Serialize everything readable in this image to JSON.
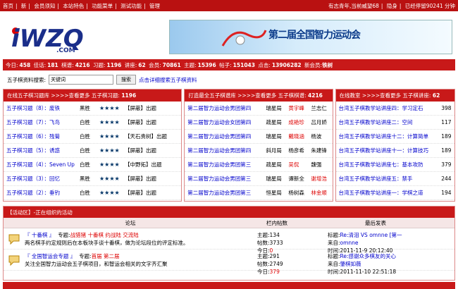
{
  "topbar": {
    "nav": [
      "首页",
      "新",
      "会员须知",
      "本站特色",
      "功能菜单",
      "测试功能",
      "管理"
    ],
    "greeting": "有志青年,当前威望68",
    "stealth": "隐身",
    "status": "已经停留90241 分钟"
  },
  "logo": {
    "text": "iWZQ",
    "sub": ".COM"
  },
  "banner": {
    "text": "第二届全国智力运动会",
    "colors": [
      "#9bc9ee",
      "#0b3b8a"
    ]
  },
  "stats": {
    "today_label": "今日:",
    "today": "458",
    "topics_label": "佳话:",
    "topics": "181",
    "chess_label": "棋谱:",
    "chess": "4216",
    "exercises_label": "习题:",
    "exercises": "1196",
    "lectures_label": "讲座:",
    "lectures": "62",
    "members_label": "会员:",
    "members": "70861",
    "topics2_label": "主题:",
    "topics2": "15396",
    "posts_label": "帖子:",
    "posts": "151043",
    "clicks_label": "点击:",
    "clicks": "13906282",
    "new_member_label": "新会员:",
    "new_member": "铁树"
  },
  "search": {
    "label": "五子棋资料搜索:",
    "value": "关键词",
    "button": "搜索",
    "advanced": "点击详细搜索五子棋资料"
  },
  "panel1": {
    "title": "在线五子棋习题库 >>>>查看更多 五子棋习题:",
    "count": "1196",
    "rows": [
      {
        "name": "五子棋习题（8）：废铁",
        "side": "黑胜",
        "stars": "★★★★",
        "tag": "【屏蔽】出题"
      },
      {
        "name": "五子棋习题（7）：飞鸟",
        "side": "白胜",
        "stars": "★★★★",
        "tag": "【屏蔽】出题"
      },
      {
        "name": "五子棋习题（6）：残菊",
        "side": "白胜",
        "stars": "★★★★",
        "tag": "【天石贵树】出题"
      },
      {
        "name": "五子棋习题（5）：诱惑",
        "side": "白胜",
        "stars": "★★★★",
        "tag": "【屏蔽】出题"
      },
      {
        "name": "五子棋习题（4）：Seven Up",
        "side": "白胜",
        "stars": "★★★★",
        "tag": "【中野拓】出题"
      },
      {
        "name": "五子棋习题（3）：回忆",
        "side": "黑胜",
        "stars": "★★★★",
        "tag": "【屏蔽】出题"
      },
      {
        "name": "五子棋习题（2）：垂钓",
        "side": "白胜",
        "stars": "★★★★",
        "tag": "【屏蔽】出题"
      }
    ]
  },
  "panel2": {
    "title": "打造最全五子棋谱库 >>>>查看更多 五子棋棋谱:",
    "count": "4216",
    "rows": [
      {
        "name": "第二届智力运动会男团第四",
        "c2": "瑞星局",
        "c3": "黄宇峰",
        "c4": "兰志仁",
        "red": true
      },
      {
        "name": "第二届智力运动会女团第四",
        "c2": "疏星局",
        "c3": "成艳珍",
        "c4": "吕月娇",
        "red": true
      },
      {
        "name": "第二届智力运动会男团第四",
        "c2": "瑞星局",
        "c3": "戴晓涵",
        "c4": "杨波",
        "red": true
      },
      {
        "name": "第二届智力运动会男团第四",
        "c2": "斜月局",
        "c3": "杨彦希",
        "c4": "朱建锋",
        "red": false
      },
      {
        "name": "第二届智力运动会男团第三",
        "c2": "疏星局",
        "c3": "吴侃",
        "c4": "魏强",
        "red": true
      },
      {
        "name": "第二届智力运动会男团第三",
        "c2": "瑞星局",
        "c3": "谭新全",
        "c4": "谢增浩",
        "red4": true
      },
      {
        "name": "第二届智力运动会男团第三",
        "c2": "恒星局",
        "c3": "杨树森",
        "c4": "林金顺",
        "red4": true
      }
    ]
  },
  "panel3": {
    "title": "在线教室 >>>>查看更多 五子棋讲座:",
    "count": "62",
    "rows": [
      {
        "name": "台湾五子棋教学站讲座四：学习定石",
        "n": "398"
      },
      {
        "name": "台湾五子棋教学站讲座二：空间",
        "n": "117"
      },
      {
        "name": "台湾五子棋教学站讲座十二：计算简单",
        "n": "189"
      },
      {
        "name": "台湾五子棋教学站讲座十一：计算技巧",
        "n": "189"
      },
      {
        "name": "台湾五子棋教学站讲座七：基本攻防",
        "n": "379"
      },
      {
        "name": "台湾五子棋教学站讲座五：禁手",
        "n": "244"
      },
      {
        "name": "台湾五子棋教学站讲座一：学棋之道",
        "n": "194"
      }
    ]
  },
  "activity": {
    "title": "【活动区】-正在组织的活动",
    "col_forum": "论坛",
    "col_posts": "栏内帖数",
    "col_last": "最后发表",
    "rows": [
      {
        "name": "『 十番棋 』",
        "topic_label": "专题:",
        "topics": "战猎猪 十番棋 约战陆 交流陆",
        "desc": "两名棋手约定规则后在本板块手谈十番棋，做为论坛段位的评定标准。",
        "t_label": "主题:",
        "t": "134",
        "p_label": "帖数:",
        "p": "3733",
        "d_label": "今日:",
        "d": "0",
        "last_title_label": "标题:",
        "last_title": "Re:清泪 VS omnne [第一",
        "from_label": "来自:",
        "from": "omnne",
        "time_label": "时间:",
        "time": "2011-11-9 20:12:40"
      },
      {
        "name": "『 全国智运会专题 』",
        "topic_label": "专题:",
        "topics": "首届 第二届",
        "desc": "关注全国智力运动会五子棋项目，和智运会相关的文字齐汇聚",
        "t_label": "主题:",
        "t": "291",
        "p_label": "帖数:",
        "p": "2749",
        "d_label": "今日:",
        "d": "379",
        "last_title_label": "标题:",
        "last_title": "Re:感谢众多棋友的关心",
        "from_label": "来自:",
        "from": "肇棋如薇",
        "time_label": "时间:",
        "time": "2011-11-10 22:51:18"
      }
    ]
  }
}
